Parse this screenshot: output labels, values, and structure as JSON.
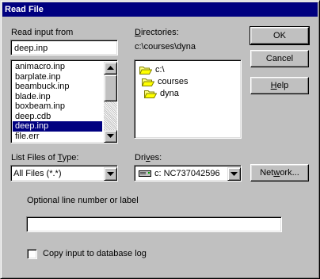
{
  "window": {
    "title": "Read File"
  },
  "file_input": {
    "label": "Read input from",
    "value": "deep.inp",
    "files": [
      {
        "name": "animacro.inp",
        "selected": false
      },
      {
        "name": "barplate.inp",
        "selected": false
      },
      {
        "name": "beambuck.inp",
        "selected": false
      },
      {
        "name": "blade.inp",
        "selected": false
      },
      {
        "name": "boxbeam.inp",
        "selected": false
      },
      {
        "name": "deep.cdb",
        "selected": false
      },
      {
        "name": "deep.inp",
        "selected": true
      },
      {
        "name": "file.err",
        "selected": false
      }
    ]
  },
  "directories": {
    "label_u": "D",
    "label_rest": "irectories:",
    "current_path": "c:\\courses\\dyna",
    "tree": [
      {
        "name": "c:\\",
        "icon": "open-folder-icon"
      },
      {
        "name": "courses",
        "icon": "open-folder-icon"
      },
      {
        "name": "dyna",
        "icon": "open-folder-icon"
      }
    ]
  },
  "buttons": {
    "ok": "OK",
    "cancel": "Cancel",
    "help_u": "H",
    "help_rest": "elp",
    "network_pre": "Net",
    "network_u": "w",
    "network_post": "ork..."
  },
  "file_type": {
    "label_pre": "List Files of ",
    "label_u": "T",
    "label_post": "ype:",
    "value": "All Files (*.*)"
  },
  "drives": {
    "label_pre": "Dri",
    "label_u": "v",
    "label_post": "es:",
    "value": "c: NC737042596"
  },
  "optional": {
    "label": "Optional line number or label",
    "value": ""
  },
  "copy_log": {
    "label": "Copy input to database log",
    "checked": false
  }
}
